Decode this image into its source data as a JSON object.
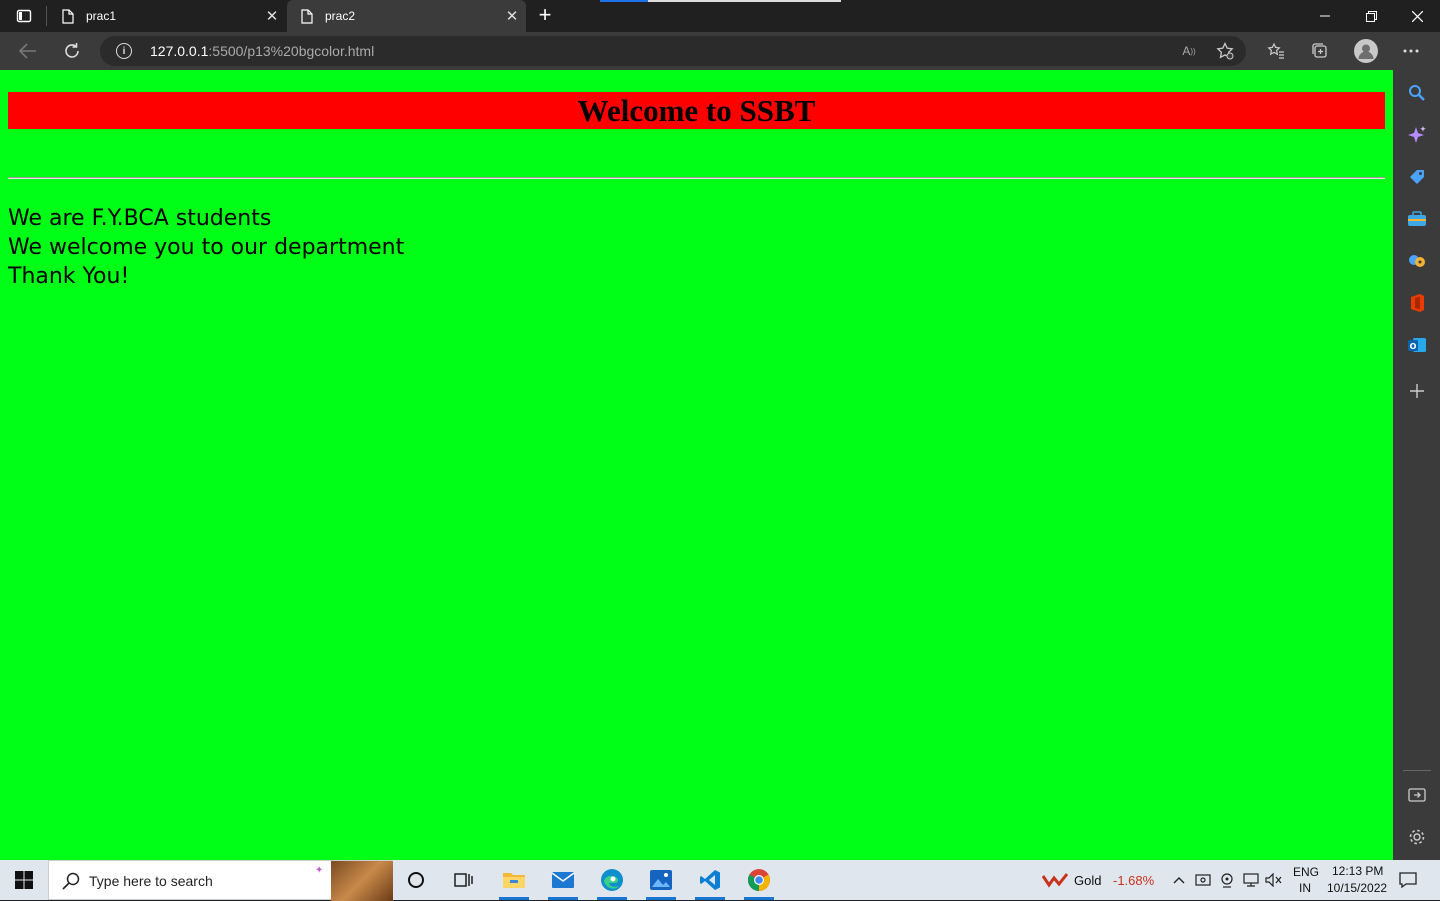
{
  "browser": {
    "tabs": [
      {
        "label": "prac1"
      },
      {
        "label": "prac2"
      }
    ],
    "address": {
      "host": "127.0.0.1",
      "rest": ":5500/p13%20bgcolor.html"
    },
    "read_aloud_label": "A"
  },
  "page": {
    "heading": "Welcome to SSBT",
    "lines": [
      "We are F.Y.BCA students",
      "We welcome you to our department",
      "Thank You!"
    ],
    "background_color": "#00ff16",
    "heading_background": "#ff0000"
  },
  "taskbar": {
    "search_placeholder": "Type here to search",
    "stock": {
      "name": "Gold",
      "change": "-1.68%"
    },
    "language": {
      "line1": "ENG",
      "line2": "IN"
    },
    "clock": {
      "time": "12:13 PM",
      "date": "10/15/2022"
    }
  }
}
